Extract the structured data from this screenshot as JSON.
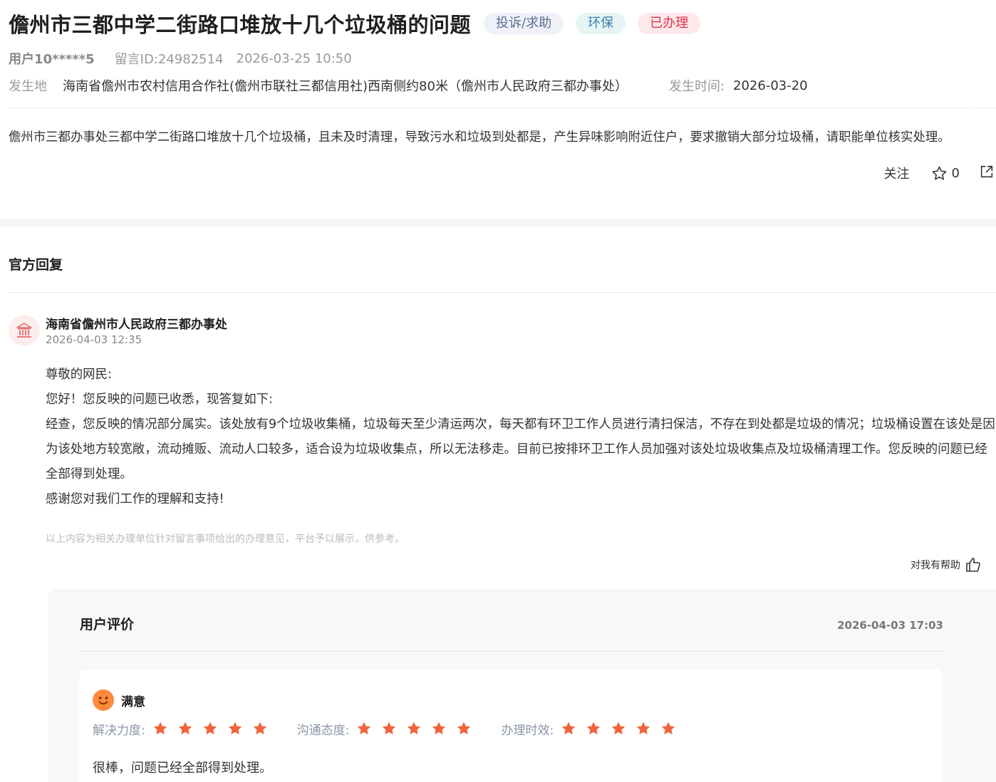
{
  "post": {
    "title": "儋州市三都中学二街路口堆放十几个垃圾桶的问题",
    "tags": [
      "投诉/求助",
      "环保",
      "已办理"
    ],
    "user": "用户10*****5",
    "message_id": "留言ID:24982514",
    "post_time": "2026-03-25 10:50",
    "location_label": "发生地",
    "location": "海南省儋州市农村信用合作社(儋州市联社三都信用社)西南侧约80米（儋州市人民政府三都办事处）",
    "event_time_label": "发生时间:",
    "event_time": "2026-03-20",
    "content": "儋州市三都办事处三都中学二街路口堆放十几个垃圾桶，且未及时清理，导致污水和垃圾到处都是，产生异味影响附近住户，要求撤销大部分垃圾桶，请职能单位核实处理。"
  },
  "actions": {
    "follow": "关注",
    "star_count": "0"
  },
  "reply": {
    "section_title": "官方回复",
    "org_name": "海南省儋州市人民政府三都办事处",
    "time": "2026-04-03 12:35",
    "paragraphs": [
      "尊敬的网民:",
      "您好！您反映的问题已收悉，现答复如下:",
      "经查，您反映的情况部分属实。该处放有9个垃圾收集桶，垃圾每天至少清运两次，每天都有环卫工作人员进行清扫保洁，不存在到处都是垃圾的情况；垃圾桶设置在该处是因为该处地方较宽敞，流动摊贩、流动人口较多，适合设为垃圾收集点，所以无法移走。目前已按排环卫工作人员加强对该处垃圾收集点及垃圾桶清理工作。您反映的问题已经全部得到处理。",
      "感谢您对我们工作的理解和支持!"
    ],
    "disclaimer": "以上内容为相关办理单位针对留言事项给出的办理意见，平台予以展示，供参考。",
    "helpful": "对我有帮助"
  },
  "evaluation": {
    "title": "用户评价",
    "time": "2026-04-03 17:03",
    "satisfaction": "满意",
    "scores": [
      {
        "label": "解决力度:",
        "stars": 5
      },
      {
        "label": "沟通态度:",
        "stars": 5
      },
      {
        "label": "办理时效:",
        "stars": 5
      }
    ],
    "comment": "很棒，问题已经全部得到处理。"
  },
  "colors": {
    "star": "#f0643c",
    "done_tag": "#e0314b",
    "emoji": "#ff8a3d"
  },
  "icons": [
    "star-outline-icon",
    "share-icon",
    "government-building-icon",
    "thumbs-up-icon",
    "smile-emoji-icon",
    "star-filled-icon"
  ]
}
